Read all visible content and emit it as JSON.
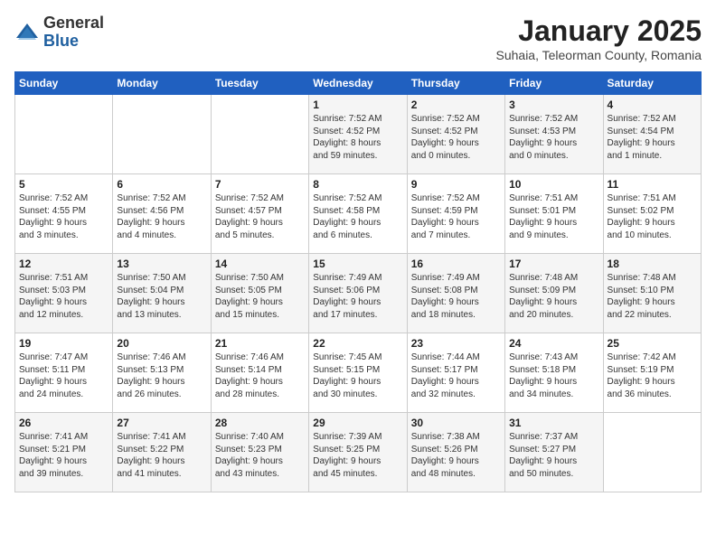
{
  "logo": {
    "general": "General",
    "blue": "Blue"
  },
  "title": "January 2025",
  "subtitle": "Suhaia, Teleorman County, Romania",
  "days_of_week": [
    "Sunday",
    "Monday",
    "Tuesday",
    "Wednesday",
    "Thursday",
    "Friday",
    "Saturday"
  ],
  "weeks": [
    [
      {
        "day": "",
        "info": ""
      },
      {
        "day": "",
        "info": ""
      },
      {
        "day": "",
        "info": ""
      },
      {
        "day": "1",
        "info": "Sunrise: 7:52 AM\nSunset: 4:52 PM\nDaylight: 8 hours\nand 59 minutes."
      },
      {
        "day": "2",
        "info": "Sunrise: 7:52 AM\nSunset: 4:52 PM\nDaylight: 9 hours\nand 0 minutes."
      },
      {
        "day": "3",
        "info": "Sunrise: 7:52 AM\nSunset: 4:53 PM\nDaylight: 9 hours\nand 0 minutes."
      },
      {
        "day": "4",
        "info": "Sunrise: 7:52 AM\nSunset: 4:54 PM\nDaylight: 9 hours\nand 1 minute."
      }
    ],
    [
      {
        "day": "5",
        "info": "Sunrise: 7:52 AM\nSunset: 4:55 PM\nDaylight: 9 hours\nand 3 minutes."
      },
      {
        "day": "6",
        "info": "Sunrise: 7:52 AM\nSunset: 4:56 PM\nDaylight: 9 hours\nand 4 minutes."
      },
      {
        "day": "7",
        "info": "Sunrise: 7:52 AM\nSunset: 4:57 PM\nDaylight: 9 hours\nand 5 minutes."
      },
      {
        "day": "8",
        "info": "Sunrise: 7:52 AM\nSunset: 4:58 PM\nDaylight: 9 hours\nand 6 minutes."
      },
      {
        "day": "9",
        "info": "Sunrise: 7:52 AM\nSunset: 4:59 PM\nDaylight: 9 hours\nand 7 minutes."
      },
      {
        "day": "10",
        "info": "Sunrise: 7:51 AM\nSunset: 5:01 PM\nDaylight: 9 hours\nand 9 minutes."
      },
      {
        "day": "11",
        "info": "Sunrise: 7:51 AM\nSunset: 5:02 PM\nDaylight: 9 hours\nand 10 minutes."
      }
    ],
    [
      {
        "day": "12",
        "info": "Sunrise: 7:51 AM\nSunset: 5:03 PM\nDaylight: 9 hours\nand 12 minutes."
      },
      {
        "day": "13",
        "info": "Sunrise: 7:50 AM\nSunset: 5:04 PM\nDaylight: 9 hours\nand 13 minutes."
      },
      {
        "day": "14",
        "info": "Sunrise: 7:50 AM\nSunset: 5:05 PM\nDaylight: 9 hours\nand 15 minutes."
      },
      {
        "day": "15",
        "info": "Sunrise: 7:49 AM\nSunset: 5:06 PM\nDaylight: 9 hours\nand 17 minutes."
      },
      {
        "day": "16",
        "info": "Sunrise: 7:49 AM\nSunset: 5:08 PM\nDaylight: 9 hours\nand 18 minutes."
      },
      {
        "day": "17",
        "info": "Sunrise: 7:48 AM\nSunset: 5:09 PM\nDaylight: 9 hours\nand 20 minutes."
      },
      {
        "day": "18",
        "info": "Sunrise: 7:48 AM\nSunset: 5:10 PM\nDaylight: 9 hours\nand 22 minutes."
      }
    ],
    [
      {
        "day": "19",
        "info": "Sunrise: 7:47 AM\nSunset: 5:11 PM\nDaylight: 9 hours\nand 24 minutes."
      },
      {
        "day": "20",
        "info": "Sunrise: 7:46 AM\nSunset: 5:13 PM\nDaylight: 9 hours\nand 26 minutes."
      },
      {
        "day": "21",
        "info": "Sunrise: 7:46 AM\nSunset: 5:14 PM\nDaylight: 9 hours\nand 28 minutes."
      },
      {
        "day": "22",
        "info": "Sunrise: 7:45 AM\nSunset: 5:15 PM\nDaylight: 9 hours\nand 30 minutes."
      },
      {
        "day": "23",
        "info": "Sunrise: 7:44 AM\nSunset: 5:17 PM\nDaylight: 9 hours\nand 32 minutes."
      },
      {
        "day": "24",
        "info": "Sunrise: 7:43 AM\nSunset: 5:18 PM\nDaylight: 9 hours\nand 34 minutes."
      },
      {
        "day": "25",
        "info": "Sunrise: 7:42 AM\nSunset: 5:19 PM\nDaylight: 9 hours\nand 36 minutes."
      }
    ],
    [
      {
        "day": "26",
        "info": "Sunrise: 7:41 AM\nSunset: 5:21 PM\nDaylight: 9 hours\nand 39 minutes."
      },
      {
        "day": "27",
        "info": "Sunrise: 7:41 AM\nSunset: 5:22 PM\nDaylight: 9 hours\nand 41 minutes."
      },
      {
        "day": "28",
        "info": "Sunrise: 7:40 AM\nSunset: 5:23 PM\nDaylight: 9 hours\nand 43 minutes."
      },
      {
        "day": "29",
        "info": "Sunrise: 7:39 AM\nSunset: 5:25 PM\nDaylight: 9 hours\nand 45 minutes."
      },
      {
        "day": "30",
        "info": "Sunrise: 7:38 AM\nSunset: 5:26 PM\nDaylight: 9 hours\nand 48 minutes."
      },
      {
        "day": "31",
        "info": "Sunrise: 7:37 AM\nSunset: 5:27 PM\nDaylight: 9 hours\nand 50 minutes."
      },
      {
        "day": "",
        "info": ""
      }
    ]
  ]
}
